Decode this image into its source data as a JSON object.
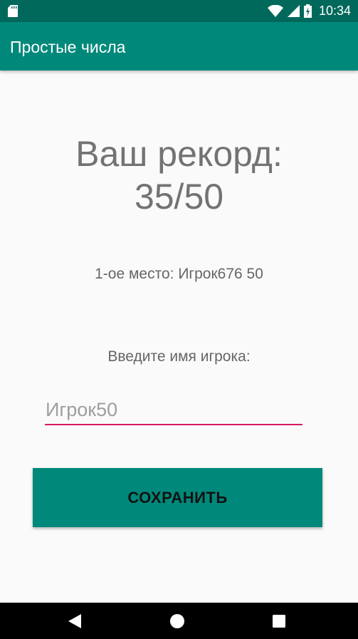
{
  "status_bar": {
    "time": "10:34",
    "icons": [
      "sd-card-icon",
      "wifi-icon",
      "signal-icon",
      "battery-charging-icon"
    ]
  },
  "app_bar": {
    "title": "Простые числа"
  },
  "main": {
    "record_line1": "Ваш рекорд:",
    "record_line2": "35/50",
    "first_place": "1-ое место: Игрок676 50",
    "prompt": "Введите имя игрока:",
    "name_input": {
      "value": "",
      "placeholder": "Игрок50"
    },
    "save_button_label": "СОХРАНИТЬ"
  },
  "nav_bar": {
    "icons": [
      "back-icon",
      "home-icon",
      "recents-icon"
    ]
  },
  "colors": {
    "status_bar": "#00695c",
    "primary": "#00897b",
    "accent": "#d81b60",
    "background": "#fafafa"
  }
}
